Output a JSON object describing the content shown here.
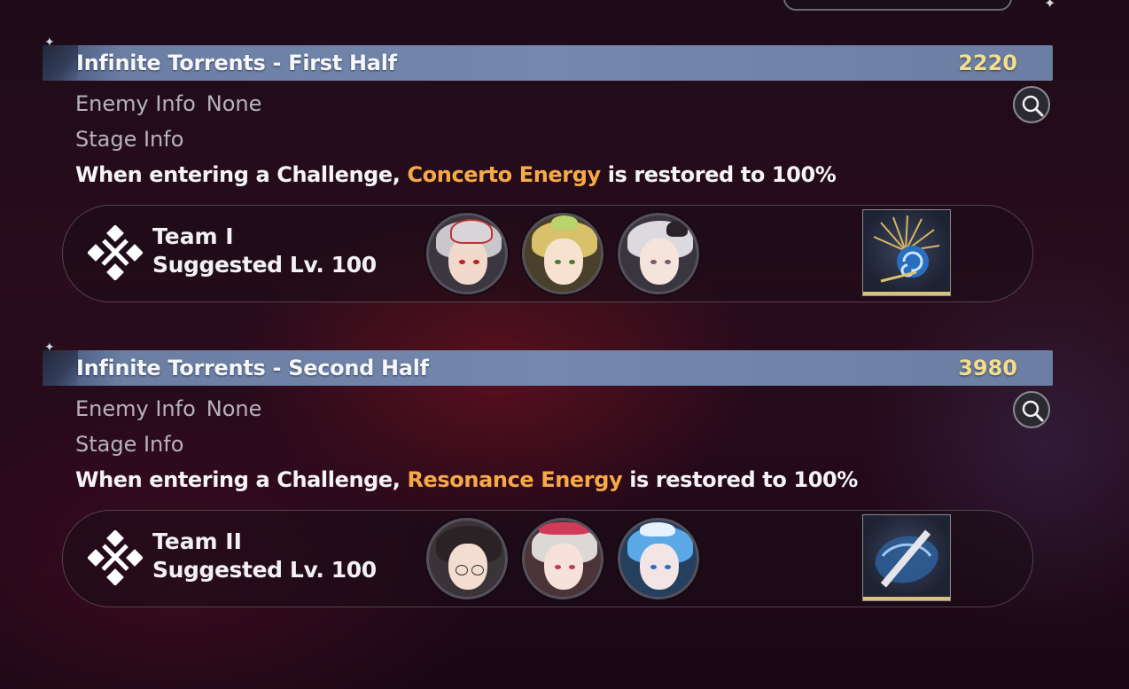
{
  "stages": [
    {
      "title": "Infinite Torrents - First Half",
      "score": "2220",
      "enemy_label": "Enemy Info",
      "enemy_value": "None",
      "stage_info_label": "Stage Info",
      "desc_prefix": "When entering a Challenge, ",
      "desc_highlight": "Concerto Energy",
      "desc_suffix": " is restored to 100%",
      "team_name": "Team I",
      "team_level": "Suggested Lv. 100",
      "characters": [
        "character-1",
        "character-2",
        "character-3"
      ],
      "echo": "echo-spiral-icon"
    },
    {
      "title": "Infinite Torrents - Second Half",
      "score": "3980",
      "enemy_label": "Enemy Info",
      "enemy_value": "None",
      "stage_info_label": "Stage Info",
      "desc_prefix": "When entering a Challenge, ",
      "desc_highlight": "Resonance Energy",
      "desc_suffix": " is restored to 100%",
      "team_name": "Team II",
      "team_level": "Suggested Lv. 100",
      "characters": [
        "character-4",
        "character-5",
        "character-6"
      ],
      "echo": "echo-wave-icon"
    }
  ],
  "colors": {
    "highlight": "#f5a948",
    "score": "#f3dd8e",
    "title_bar": "#7487ad"
  }
}
